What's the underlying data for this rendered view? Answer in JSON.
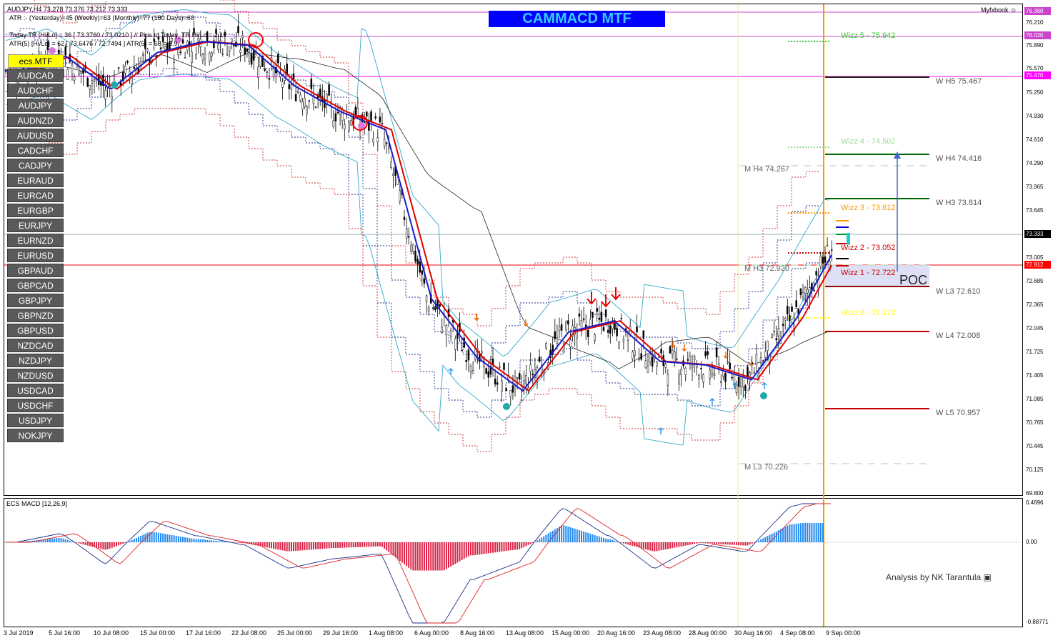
{
  "header": {
    "symbol_line": "AUDJPY,H4  73.278 73.376 73.212 73.333",
    "atr_line": "ATR :- (Yesterday)=45      (Weekly)=63      (Monthly)=77      (180 Days)=68",
    "today_tr_line": "Today  TR [Hi/Lo] = 36 [ 73.3760 / 73.0210 ]   // Pips to Today_TR Hi/Lo = 2.1",
    "atr5_line": "ATR(5)     [Hi/Lo] = 62 [ 73.6476 / 72.7494 ]   ATR(5) = 68 = 2.9",
    "brand": "Myfxbook"
  },
  "banner": {
    "title": "CAMMACD MTF"
  },
  "panel": {
    "active_button": "ecs.MTF",
    "symbols": [
      "AUDCAD",
      "AUDCHF",
      "AUDJPY",
      "AUDNZD",
      "AUDUSD",
      "CADCHF",
      "CADJPY",
      "EURAUD",
      "EURCAD",
      "EURGBP",
      "EURJPY",
      "EURNZD",
      "EURUSD",
      "GBPAUD",
      "GBPCAD",
      "GBPJPY",
      "GBPNZD",
      "GBPUSD",
      "NZDCAD",
      "NZDJPY",
      "NZDUSD",
      "USDCAD",
      "USDCHF",
      "USDJPY",
      "NOKJPY"
    ]
  },
  "price_axis": {
    "ticks": [
      "76.210",
      "75.890",
      "75.570",
      "75.250",
      "74.930",
      "74.610",
      "74.290",
      "73.965",
      "73.645",
      "73.005",
      "72.685",
      "72.365",
      "72.045",
      "71.725",
      "71.405",
      "71.085",
      "70.765",
      "70.445",
      "70.125",
      "69.800"
    ],
    "highlights": [
      {
        "label": "76.360",
        "bg": "#cc44cc",
        "fg": "#ffffff"
      },
      {
        "label": "76.020",
        "bg": "#cc44cc",
        "fg": "#ffffff"
      },
      {
        "label": "75.470",
        "bg": "#ff00ff",
        "fg": "#ffffff"
      },
      {
        "label": "73.333",
        "bg": "#000000",
        "fg": "#ffffff"
      },
      {
        "label": "72.912",
        "bg": "#ff0000",
        "fg": "#ffffff"
      }
    ]
  },
  "date_axis": [
    "3 Jul 2019",
    "5 Jul 16:00",
    "10 Jul 08:00",
    "15 Jul 00:00",
    "17 Jul 16:00",
    "22 Jul 08:00",
    "25 Jul 00:00",
    "29 Jul 16:00",
    "1 Aug 08:00",
    "6 Aug 00:00",
    "8 Aug 16:00",
    "13 Aug 08:00",
    "15 Aug 00:00",
    "20 Aug 16:00",
    "23 Aug 08:00",
    "28 Aug 00:00",
    "30 Aug 16:00",
    "4 Sep 08:00",
    "9 Sep 00:00"
  ],
  "wizz_levels": [
    {
      "label": "Wizz 5 - 75.942",
      "color": "#33cc33"
    },
    {
      "label": "Wizz 4 - 74.502",
      "color": "#99dd99"
    },
    {
      "label": "Wizz 3 - 73.612",
      "color": "#ff9900"
    },
    {
      "label": "Wizz 2 - 73.052",
      "color": "#cc0000"
    },
    {
      "label": "Wizz 1 - 72.722",
      "color": "#cc0000"
    },
    {
      "label": "Wizz 0 - 72.172",
      "color": "#ffff00"
    }
  ],
  "weekly_levels": [
    {
      "label": "W  H5 75.467",
      "color": "#333333"
    },
    {
      "label": "W  H4 74.416",
      "color": "#006600"
    },
    {
      "label": "W  H3 73.814",
      "color": "#006600"
    },
    {
      "label": "W  L3 72.610",
      "color": "#990000"
    },
    {
      "label": "W  L4 72.008",
      "color": "#cc0000"
    },
    {
      "label": "W  L5 70.957",
      "color": "#cc0000"
    }
  ],
  "monthly_levels": [
    "M  H4 74.267",
    "M  H3 72.920",
    "M  L3 70.226"
  ],
  "poc_label": "POC",
  "macd": {
    "label": "ECS MACD [12,26,9]",
    "ticks": [
      "0.4696",
      "0.00",
      "-0.88771"
    ]
  },
  "credit": "Analysis by NK Tarantula",
  "chart_data": {
    "type": "line",
    "title": "AUDJPY,H4",
    "x": [
      "3 Jul 2019",
      "5 Jul 16:00",
      "10 Jul 08:00",
      "15 Jul 00:00",
      "17 Jul 16:00",
      "22 Jul 08:00",
      "25 Jul 00:00",
      "29 Jul 16:00",
      "1 Aug 08:00",
      "6 Aug 00:00",
      "8 Aug 16:00",
      "13 Aug 08:00",
      "15 Aug 00:00",
      "20 Aug 16:00",
      "23 Aug 08:00",
      "28 Aug 00:00",
      "30 Aug 16:00",
      "4 Sep 08:00",
      "9 Sep 00:00"
    ],
    "series": [
      {
        "values": [
          75.55,
          75.75,
          75.3,
          75.8,
          75.95,
          75.9,
          75.35,
          75.0,
          74.75,
          72.45,
          71.65,
          71.2,
          72.0,
          72.15,
          71.6,
          71.55,
          71.35,
          72.2,
          73.33
        ]
      }
    ],
    "ylim": [
      69.8,
      76.36
    ],
    "macd_ylim": [
      -0.88771,
      0.4696
    ]
  }
}
